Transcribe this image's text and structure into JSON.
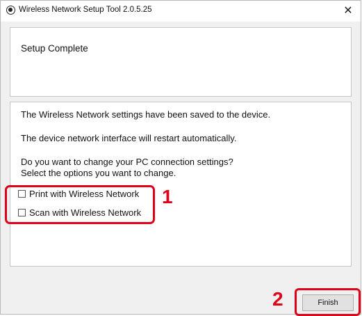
{
  "window": {
    "title": "Wireless Network Setup Tool 2.0.5.25",
    "close_glyph": "✕"
  },
  "header": {
    "title": "Setup Complete"
  },
  "content": {
    "line1": "The Wireless Network settings have been saved to the device.",
    "line2": "The device network interface will restart automatically.",
    "line3": "Do you want to change your PC connection settings?",
    "line4": "Select the options you want to change.",
    "options": [
      {
        "label": "Print with Wireless Network",
        "checked": false
      },
      {
        "label": "Scan with Wireless Network",
        "checked": false
      }
    ]
  },
  "annotations": {
    "step1": "1",
    "step2": "2",
    "color": "#e0001a"
  },
  "footer": {
    "finish_label": "Finish"
  }
}
